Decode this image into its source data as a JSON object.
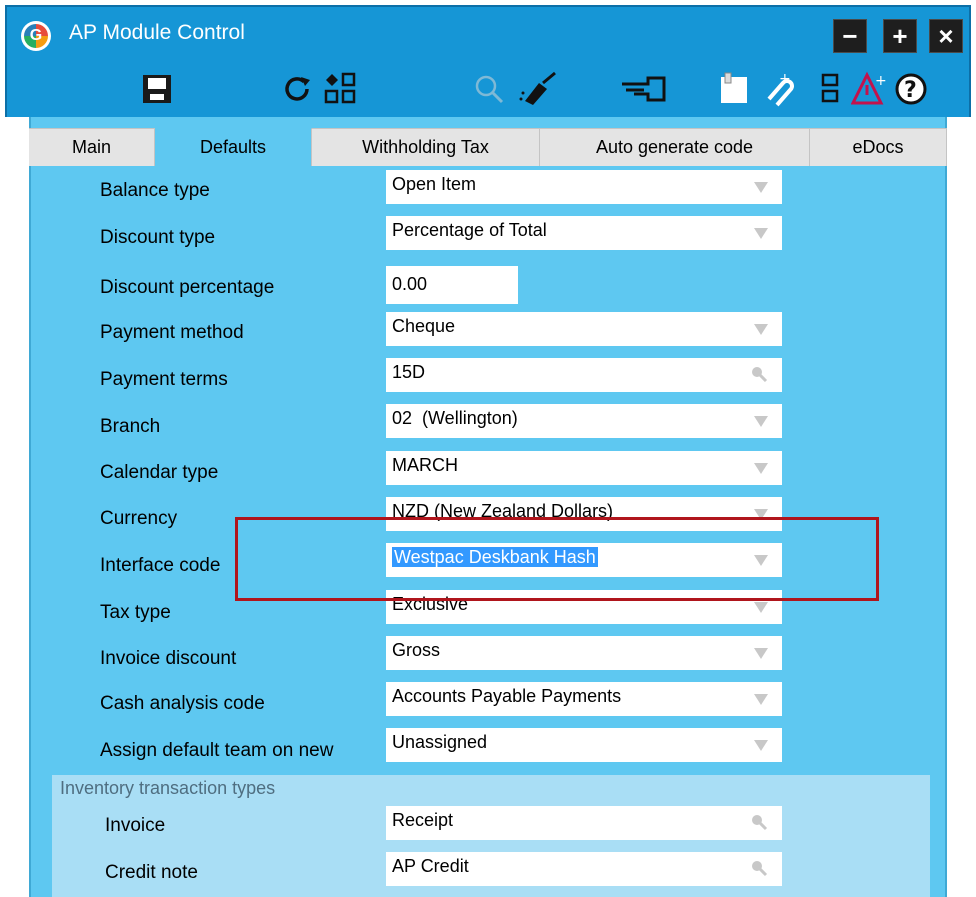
{
  "window": {
    "title": "AP Module Control",
    "logo_letter": "G",
    "controls": {
      "minimize": "−",
      "maximize": "+",
      "close": "×"
    }
  },
  "toolbar": {
    "icons": [
      "save-icon",
      "refresh-icon",
      "modules-icon",
      "search-icon",
      "clear-icon",
      "pointer-icon",
      "notes-icon",
      "attach-icon",
      "layout-icon",
      "alert-icon",
      "help-icon"
    ]
  },
  "tabs": [
    {
      "label": "Main"
    },
    {
      "label": "Defaults",
      "active": true
    },
    {
      "label": "Withholding Tax"
    },
    {
      "label": "Auto generate code"
    },
    {
      "label": "eDocs"
    }
  ],
  "fields": {
    "balance_type": {
      "label": "Balance type",
      "value": "Open Item"
    },
    "discount_type": {
      "label": "Discount type",
      "value": "Percentage of Total"
    },
    "discount_percentage": {
      "label": "Discount percentage",
      "value": "0.00"
    },
    "payment_method": {
      "label": "Payment method",
      "value": "Cheque"
    },
    "payment_terms": {
      "label": "Payment terms",
      "value": "15D"
    },
    "branch": {
      "label": "Branch",
      "value": "02  (Wellington)"
    },
    "calendar_type": {
      "label": "Calendar type",
      "value": "MARCH"
    },
    "currency": {
      "label": "Currency",
      "value": "NZD (New Zealand Dollars)"
    },
    "interface_code": {
      "label": "Interface code",
      "value": "Westpac Deskbank Hash"
    },
    "tax_type": {
      "label": "Tax type",
      "value": "Exclusive"
    },
    "invoice_discount": {
      "label": "Invoice discount",
      "value": "Gross"
    },
    "cash_analysis_code": {
      "label": "Cash analysis code",
      "value": "Accounts Payable Payments"
    },
    "assign_default_team": {
      "label": "Assign default team on new",
      "value": "Unassigned"
    }
  },
  "inventory_group": {
    "title": "Inventory transaction types",
    "invoice": {
      "label": "Invoice",
      "value": "Receipt"
    },
    "credit_note": {
      "label": "Credit note",
      "value": "AP Credit"
    }
  },
  "colors": {
    "titlebar": "#1696d6",
    "panel": "#5ec8f1",
    "highlight": "#b0151c",
    "selection": "#3399ff"
  }
}
